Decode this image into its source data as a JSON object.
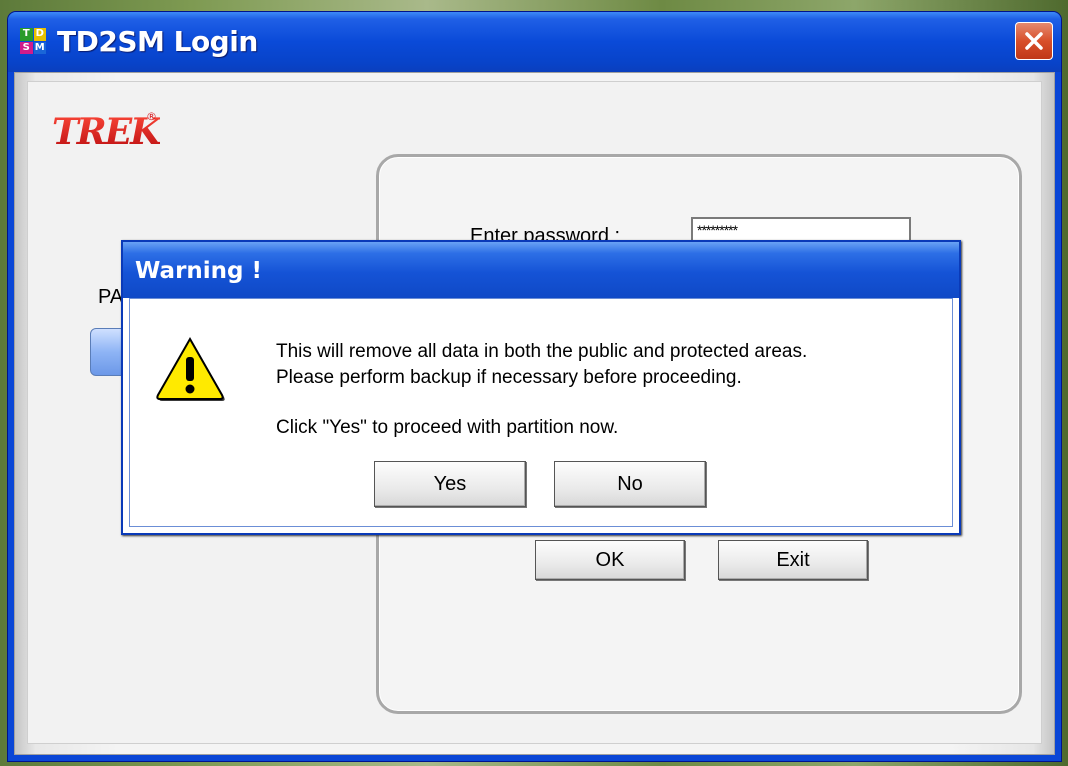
{
  "window": {
    "title": "TD2SM Login",
    "app_icon_letters": [
      "T",
      "D",
      "S",
      "M"
    ],
    "close_symbol": "✕"
  },
  "logo": {
    "text": "TREK",
    "mark": "®"
  },
  "login": {
    "password_label": "Enter password :",
    "password_value": "*********",
    "partial_label": "PA",
    "ok_label": "OK",
    "exit_label": "Exit"
  },
  "dialog": {
    "title": "Warning !",
    "message_line1": "This will remove all data in both the public and protected areas.",
    "message_line2": "Please perform backup if necessary before proceeding.",
    "message_line3": "Click \"Yes\" to proceed with partition now.",
    "yes_label": "Yes",
    "no_label": "No",
    "icon": "warning-icon"
  },
  "colors": {
    "titlebar": "#0a4ad8",
    "dialog_title": "#1553d6",
    "warning_yellow": "#ffea00",
    "logo_red": "#d8141a"
  }
}
